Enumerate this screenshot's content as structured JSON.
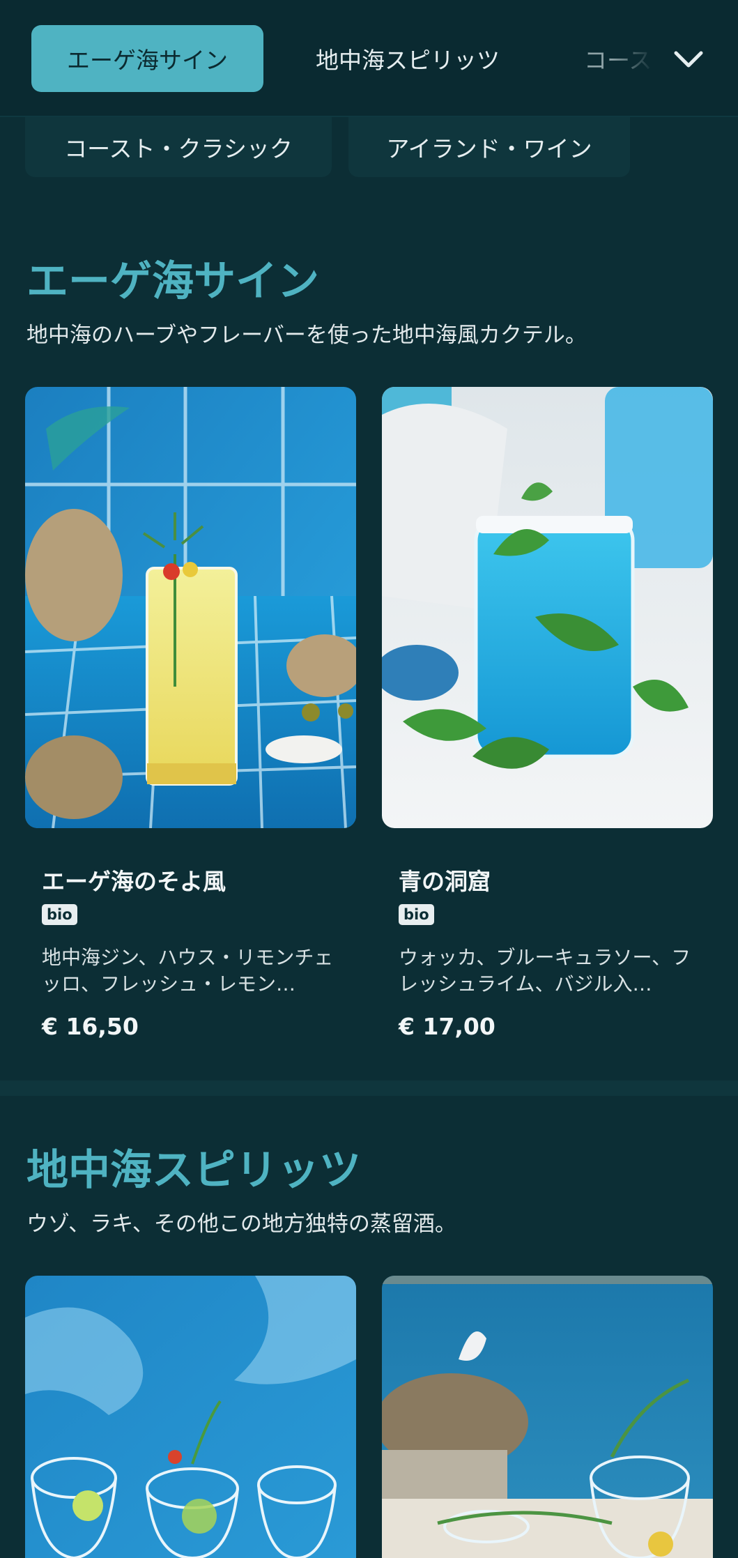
{
  "nav": {
    "tabs": [
      {
        "label": "エーゲ海サイン",
        "active": true
      },
      {
        "label": "地中海スピリッツ",
        "active": false
      },
      {
        "label": "コース",
        "active": false
      }
    ],
    "subtabs": [
      "コースト・クラシック",
      "アイランド・ワイン"
    ],
    "expand_icon": "chevron-down-icon"
  },
  "sections": [
    {
      "title": "エーゲ海サイン",
      "description": "地中海のハーブやフレーバーを使った地中海風カクテル。",
      "items": [
        {
          "name": "エーゲ海のそよ風",
          "badge": "bio",
          "description": "地中海ジン、ハウス・リモンチェッロ、フレッシュ・レモン…",
          "price": "€ 16,50"
        },
        {
          "name": "青の洞窟",
          "badge": "bio",
          "description": "ウォッカ、ブルーキュラソー、フレッシュライム、バジル入…",
          "price": "€ 17,00"
        }
      ]
    },
    {
      "title": "地中海スピリッツ",
      "description": "ウゾ、ラキ、その他この地方独特の蒸留酒。",
      "items": []
    }
  ],
  "colors": {
    "background": "#0c2e35",
    "accent": "#4fb3c2",
    "nav_background": "#0a2a31"
  }
}
